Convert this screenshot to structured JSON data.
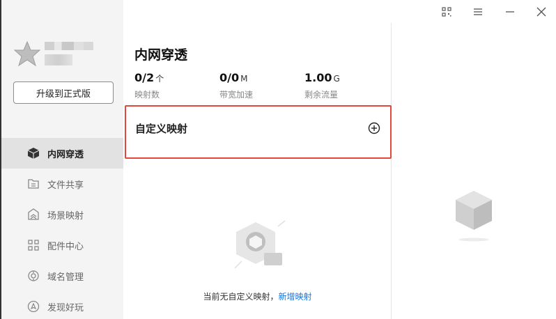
{
  "sidebar": {
    "upgrade_label": "升级到正式版",
    "items": [
      {
        "label": "内网穿透",
        "icon": "cube-icon",
        "active": true
      },
      {
        "label": "文件共享",
        "icon": "folder-share-icon",
        "active": false
      },
      {
        "label": "场景映射",
        "icon": "scene-icon",
        "active": false
      },
      {
        "label": "配件中心",
        "icon": "grid-icon",
        "active": false
      },
      {
        "label": "域名管理",
        "icon": "domain-icon",
        "active": false
      },
      {
        "label": "发现好玩",
        "icon": "discover-icon",
        "active": false
      }
    ]
  },
  "panel": {
    "title": "内网穿透",
    "stats": [
      {
        "value": "0/2",
        "unit": "个",
        "label": "映射数"
      },
      {
        "value": "0/0",
        "unit": "M",
        "label": "带宽加速"
      },
      {
        "value": "1.00",
        "unit": "G",
        "label": "剩余流量"
      }
    ],
    "custom_mapping_title": "自定义映射",
    "empty_text": "当前无自定义映射，",
    "empty_link": "新增映射"
  },
  "colors": {
    "highlight_border": "#e0483a",
    "link": "#1a73d8"
  }
}
